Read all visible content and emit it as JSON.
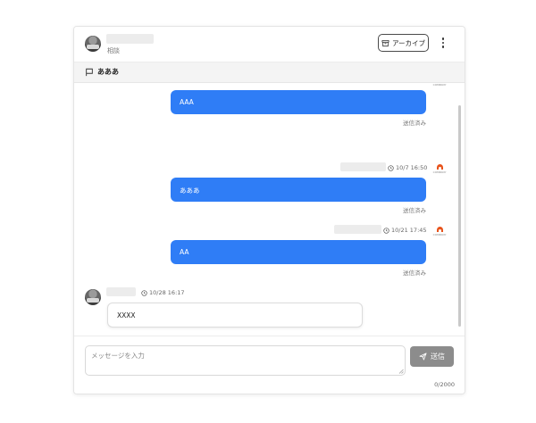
{
  "header": {
    "subtitle": "相談",
    "archive_label": "アーカイブ"
  },
  "subject": {
    "text": "あああ"
  },
  "messages": [
    {
      "direction": "outgoing",
      "text": "AAA",
      "status": "送信済み"
    },
    {
      "direction": "outgoing",
      "timestamp": "10/7 16:50",
      "text": "あああ",
      "status": "送信済み",
      "logo_text": "COMPANY"
    },
    {
      "direction": "outgoing",
      "timestamp": "10/21 17:45",
      "text": "AA",
      "status": "送信済み",
      "logo_text": "COMPANY"
    },
    {
      "direction": "incoming",
      "timestamp": "10/28 16:17",
      "text": "XXXX"
    }
  ],
  "composer": {
    "value": "",
    "placeholder": "メッセージを入力",
    "send_label": "送信",
    "char_count": "0/2000"
  },
  "colors": {
    "outgoing_bubble": "#2f7df6",
    "send_button": "#8c8c8c"
  },
  "icons": {
    "archive": "archive-box-icon",
    "more": "kebab-menu-icon",
    "subject": "flag-icon",
    "clock": "clock-icon",
    "send": "paper-plane-icon"
  }
}
